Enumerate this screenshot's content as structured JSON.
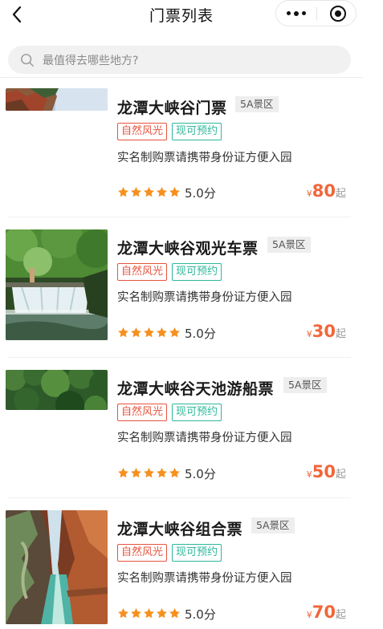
{
  "header": {
    "title": "门票列表"
  },
  "search": {
    "placeholder": "最值得去哪些地方?"
  },
  "colors": {
    "price": "#f1663a",
    "star": "#f6901e",
    "tag_nature": "#e5543f",
    "tag_booking": "#2fb79b"
  },
  "tickets": [
    {
      "name": "龙潭大峡谷门票",
      "badge": "5A景区",
      "tag1": "自然风光",
      "tag2": "现可预约",
      "desc": "实名制购票请携带身份证方便入园",
      "rating": "5.0分",
      "currency": "¥",
      "price": "80",
      "price_suffix": "起",
      "stars": 5
    },
    {
      "name": "龙潭大峡谷观光车票",
      "badge": "5A景区",
      "tag1": "自然风光",
      "tag2": "现可预约",
      "desc": "实名制购票请携带身份证方便入园",
      "rating": "5.0分",
      "currency": "¥",
      "price": "30",
      "price_suffix": "起",
      "stars": 5
    },
    {
      "name": "龙潭大峡谷天池游船票",
      "badge": "5A景区",
      "tag1": "自然风光",
      "tag2": "现可预约",
      "desc": "实名制购票请携带身份证方便入园",
      "rating": "5.0分",
      "currency": "¥",
      "price": "50",
      "price_suffix": "起",
      "stars": 5
    },
    {
      "name": "龙潭大峡谷组合票",
      "badge": "5A景区",
      "tag1": "自然风光",
      "tag2": "现可预约",
      "desc": "实名制购票请携带身份证方便入园",
      "rating": "5.0分",
      "currency": "¥",
      "price": "70",
      "price_suffix": "起",
      "stars": 5
    }
  ]
}
